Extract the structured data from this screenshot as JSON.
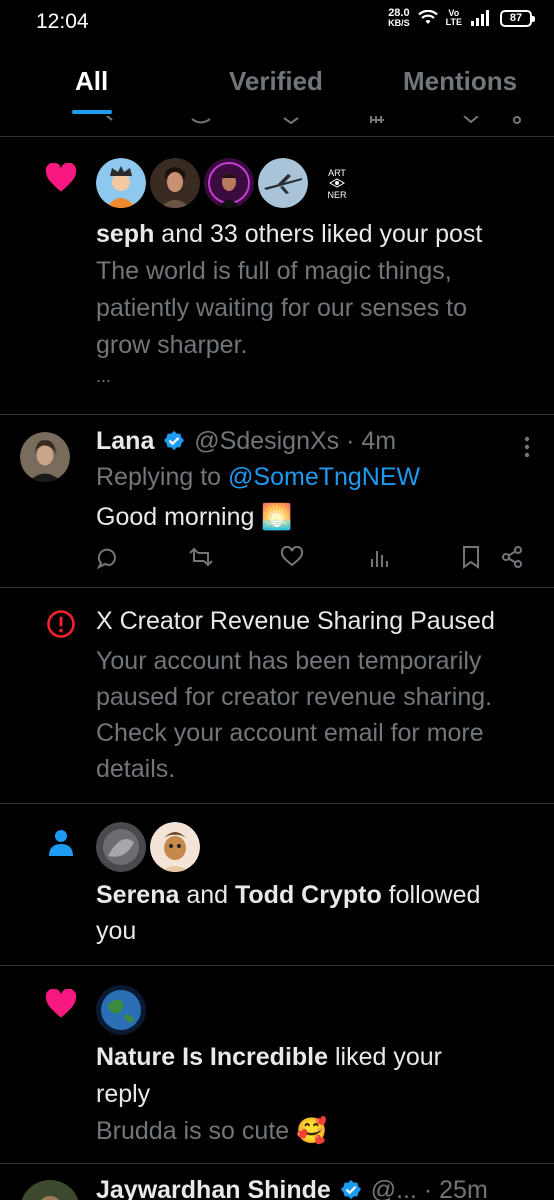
{
  "status_bar": {
    "time": "12:04",
    "net_speed_value": "28.0",
    "net_speed_unit": "KB/S",
    "volte_top": "Vo",
    "volte_bottom": "LTE",
    "battery": "87"
  },
  "tabs": [
    {
      "label": "All",
      "active": true
    },
    {
      "label": "Verified",
      "active": false
    },
    {
      "label": "Mentions",
      "active": false
    }
  ],
  "notifications": {
    "like_post": {
      "icon": "heart-icon",
      "brand_badge_line1": "ART",
      "brand_badge_line2": "NER",
      "actor": "seph",
      "action_text": " and 33 others liked your post",
      "post_line1": "The world is full of magic things,",
      "post_line2": "patiently waiting for our senses to",
      "post_line3": "grow sharper.",
      "ellipsis": "..."
    },
    "reply": {
      "name": "Lana",
      "handle": "@SdesignXs",
      "separator": " · ",
      "time": "4m",
      "replying_prefix": "Replying to ",
      "replying_to": "@SomeTngNEW",
      "body": "Good morning 🌅"
    },
    "revenue": {
      "icon": "alert-circle-icon",
      "title": "X Creator Revenue Sharing Paused",
      "line1": "Your account has been temporarily",
      "line2": "paused for creator revenue sharing.",
      "line3": "Check your account email for more",
      "line4": "details."
    },
    "follow": {
      "icon": "person-icon",
      "actor1": "Serena",
      "middle": " and ",
      "actor2": "Todd Crypto",
      "action_line1": " followed",
      "action_line2": "you"
    },
    "like_reply": {
      "icon": "heart-icon",
      "actor": "Nature Is Incredible",
      "action_line1": " liked your",
      "action_line2": "reply",
      "reply_text": "Brudda is so cute 🥰"
    },
    "next": {
      "name": "Jaywardhan Shinde",
      "handle": "@...",
      "separator": " · ",
      "time": "25m"
    }
  },
  "colors": {
    "background": "#000000",
    "accent": "#1d9bf0",
    "heart": "#f91880",
    "alert": "#f4212e",
    "muted": "#71767b"
  }
}
